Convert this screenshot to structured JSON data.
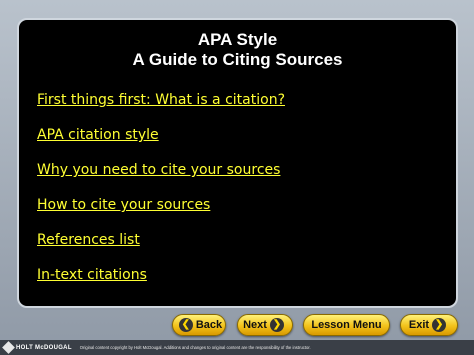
{
  "slide": {
    "title_line1": "APA Style",
    "title_line2": "A Guide to Citing Sources",
    "links": [
      "First things first: What is a citation?",
      "APA citation style",
      "Why you need to cite your sources",
      "How to cite your sources",
      "References list",
      "In-text citations"
    ]
  },
  "nav": {
    "back_label": "Back",
    "next_label": "Next",
    "lesson_menu_label": "Lesson Menu",
    "exit_label": "Exit"
  },
  "footer": {
    "logo_text": "HOLT McDOUGAL",
    "copyright": "Original content copyright by Holt McDougal. Additions and changes to original content are the responsibility of the instructor."
  },
  "colors": {
    "slide_bg": "#000000",
    "link": "#ffff33",
    "button": "#f2c21a"
  }
}
